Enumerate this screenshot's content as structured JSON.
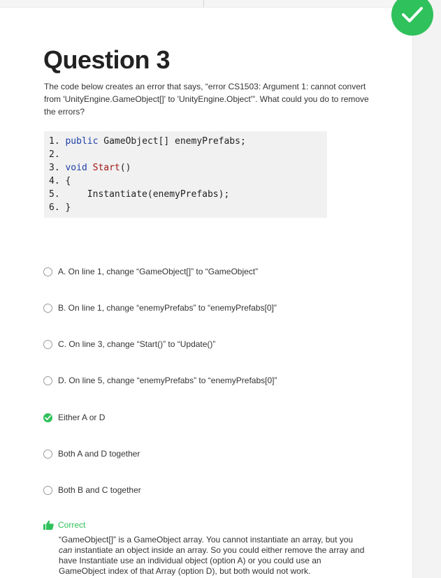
{
  "question": {
    "title": "Question 3",
    "text": "The code below creates an error that says, “error CS1503: Argument 1: cannot convert from 'UnityEngine.GameObject[]' to 'UnityEngine.Object'”.  What could you do to remove the errors?"
  },
  "code": {
    "lines": [
      {
        "num": "1.",
        "kw": "public",
        "rest": " GameObject[] enemyPrefabs;"
      },
      {
        "num": "2.",
        "kw": "",
        "rest": ""
      },
      {
        "num": "3.",
        "kw": "void",
        "fn": "Start",
        "rest": "()"
      },
      {
        "num": "4.",
        "kw": "",
        "rest": "{"
      },
      {
        "num": "5.",
        "kw": "",
        "rest": "    Instantiate(enemyPrefabs);"
      },
      {
        "num": "6.",
        "kw": "",
        "rest": "}"
      }
    ]
  },
  "options": [
    {
      "label": "A. On line 1, change “GameObject[]” to “GameObject”",
      "selected": false
    },
    {
      "label": "B. On line 1, change “enemyPrefabs” to “enemyPrefabs[0]”",
      "selected": false
    },
    {
      "label": "C. On line 3, change “Start()” to “Update()”",
      "selected": false
    },
    {
      "label": "D. On line 5, change “enemyPrefabs” to “enemyPrefabs[0]”",
      "selected": false
    },
    {
      "label": "Either A or D",
      "selected": true
    },
    {
      "label": "Both A and D together",
      "selected": false
    },
    {
      "label": "Both B and C together",
      "selected": false
    }
  ],
  "feedback": {
    "title": "Correct",
    "text_before": "“GameObject[]” is a GameObject array. You cannot instantiate an array, but you ",
    "text_em": "can",
    "text_after": " instantiate an object inside an array. So you could either remove the array and have Instantiate use an individual object (option A) or you could use an GameObject index of that Array (option D), but both would not work."
  },
  "colors": {
    "accent": "#2fc15b",
    "keyword": "#1e3fa8",
    "function": "#a31515"
  }
}
